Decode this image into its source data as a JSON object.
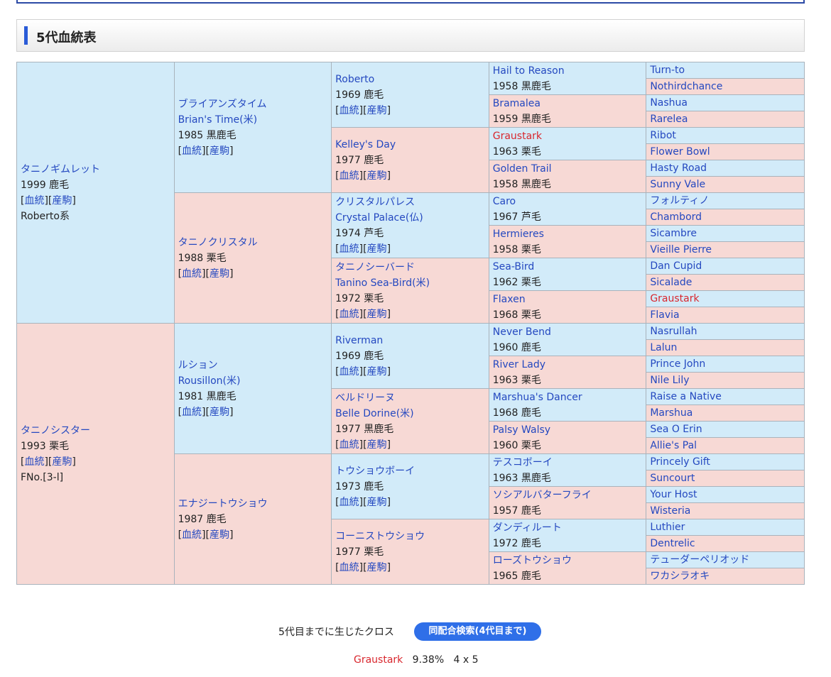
{
  "section_title": "5代血統表",
  "bloodline_label": "血統",
  "progeny_label": "産駒",
  "horse": {
    "name": "タニノギムレット",
    "info": "1999 鹿毛",
    "line": "Roberto系"
  },
  "dam": {
    "name": "タニノシスター",
    "info": "1993 栗毛",
    "fno": "FNo.[3-l]"
  },
  "g2": [
    {
      "name": "ブライアンズタイム",
      "en": "Brian's Time(米)",
      "info": "1985 黒鹿毛"
    },
    {
      "name": "タニノクリスタル",
      "en": "",
      "info": "1988 栗毛"
    },
    {
      "name": "ルション",
      "en": "Rousillon(米)",
      "info": "1981 黒鹿毛"
    },
    {
      "name": "エナジートウショウ",
      "en": "",
      "info": "1987 鹿毛"
    }
  ],
  "g3": [
    {
      "name": "Roberto",
      "en": "",
      "info": "1969 鹿毛"
    },
    {
      "name": "Kelley's Day",
      "en": "",
      "info": "1977 鹿毛"
    },
    {
      "name": "クリスタルパレス",
      "en": "Crystal Palace(仏)",
      "info": "1974 芦毛"
    },
    {
      "name": "タニノシーバード",
      "en": "Tanino Sea-Bird(米)",
      "info": "1972 栗毛"
    },
    {
      "name": "Riverman",
      "en": "",
      "info": "1969 鹿毛"
    },
    {
      "name": "ベルドリーヌ",
      "en": "Belle Dorine(米)",
      "info": "1977 黒鹿毛"
    },
    {
      "name": "トウショウボーイ",
      "en": "",
      "info": "1973 鹿毛"
    },
    {
      "name": "コーニストウショウ",
      "en": "",
      "info": "1977 栗毛"
    }
  ],
  "g4": [
    {
      "name": "Hail to Reason",
      "info": "1958 黒鹿毛"
    },
    {
      "name": "Bramalea",
      "info": "1959 黒鹿毛"
    },
    {
      "name": "Graustark",
      "info": "1963 栗毛"
    },
    {
      "name": "Golden Trail",
      "info": "1958 黒鹿毛"
    },
    {
      "name": "Caro",
      "info": "1967 芦毛"
    },
    {
      "name": "Hermieres",
      "info": "1958 栗毛"
    },
    {
      "name": "Sea-Bird",
      "info": "1962 栗毛"
    },
    {
      "name": "Flaxen",
      "info": "1968 栗毛"
    },
    {
      "name": "Never Bend",
      "info": "1960 鹿毛"
    },
    {
      "name": "River Lady",
      "info": "1963 栗毛"
    },
    {
      "name": "Marshua's Dancer",
      "info": "1968 鹿毛"
    },
    {
      "name": "Palsy Walsy",
      "info": "1960 栗毛"
    },
    {
      "name": "テスコボーイ",
      "info": "1963 黒鹿毛"
    },
    {
      "name": "ソシアルバターフライ",
      "info": "1957 鹿毛"
    },
    {
      "name": "ダンディルート",
      "info": "1972 鹿毛"
    },
    {
      "name": "ローズトウショウ",
      "info": "1965 鹿毛"
    }
  ],
  "g5": [
    "Turn-to",
    "Nothirdchance",
    "Nashua",
    "Rarelea",
    "Ribot",
    "Flower Bowl",
    "Hasty Road",
    "Sunny Vale",
    "フォルティノ",
    "Chambord",
    "Sicambre",
    "Vieille Pierre",
    "Dan Cupid",
    "Sicalade",
    "Graustark",
    "Flavia",
    "Nasrullah",
    "Lalun",
    "Prince John",
    "Nile Lily",
    "Raise a Native",
    "Marshua",
    "Sea O Erin",
    "Allie's Pal",
    "Princely Gift",
    "Suncourt",
    "Your Host",
    "Wisteria",
    "Luthier",
    "Dentrelic",
    "テューダーペリオッド",
    "ワカシラオキ"
  ],
  "cross": {
    "label": "5代目までに生じたクロス",
    "button": "同配合検索(4代目まで)",
    "name": "Graustark",
    "pct": "9.38%",
    "gen": "4 x 5"
  }
}
